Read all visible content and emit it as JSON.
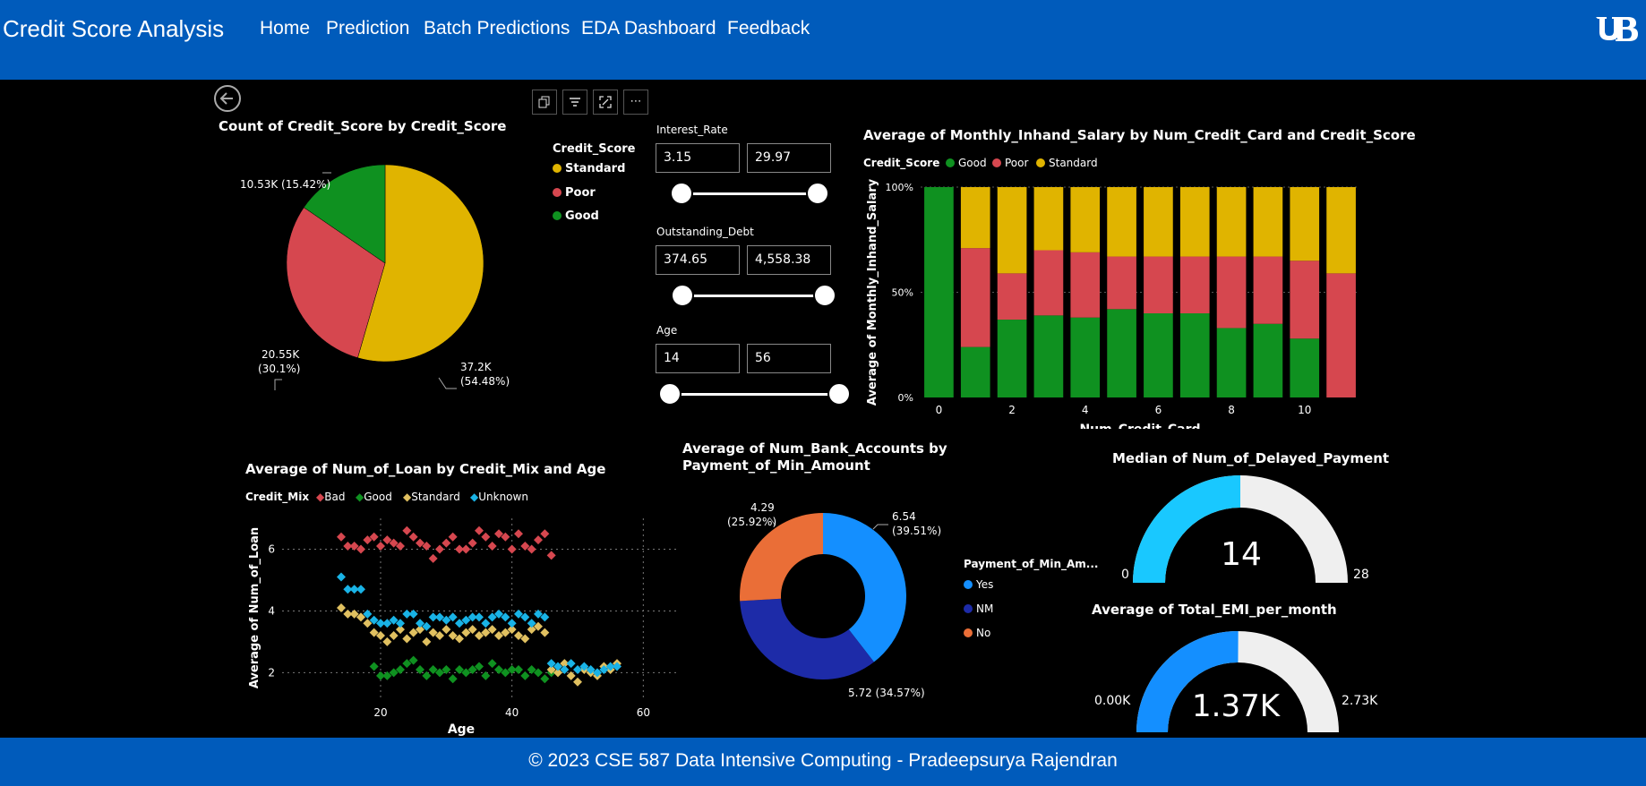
{
  "nav": {
    "brand": "Credit Score Analysis",
    "items": [
      "Home",
      "Prediction",
      "Batch Predictions",
      "EDA Dashboard",
      "Feedback"
    ],
    "logo": "ub-logo"
  },
  "footer": {
    "text": "© 2023 CSE 587 Data Intensive Computing - Pradeepsurya Rajendran"
  },
  "toolbar": {
    "icons": [
      "back-arrow-icon",
      "copy-icon",
      "filter-icon",
      "focus-mode-icon",
      "more-options-icon"
    ],
    "more_label": "⋯"
  },
  "colors": {
    "standard": "#e0b400",
    "poor": "#d6474f",
    "good": "#0f9120",
    "bad": "#d6474f",
    "unknown": "#19b3e6",
    "yes": "#148fff",
    "nm": "#1d2ba8",
    "no": "#ea6e37",
    "nav": "#005bbb",
    "gauge_track": "#efefef"
  },
  "pie": {
    "title": "Count of Credit_Score by Credit_Score",
    "legend_title": "Credit_Score",
    "legend": [
      "Standard",
      "Poor",
      "Good"
    ],
    "labels": {
      "good": "10.53K (15.42%)",
      "poor_1": "20.55K",
      "poor_2": "(30.1%)",
      "standard_1": "37.2K",
      "standard_2": "(54.48%)"
    }
  },
  "slicers": {
    "interest": {
      "title": "Interest_Rate",
      "min": "3.15",
      "max": "29.97"
    },
    "debt": {
      "title": "Outstanding_Debt",
      "min": "374.65",
      "max": "4,558.38"
    },
    "age": {
      "title": "Age",
      "min": "14",
      "max": "56"
    }
  },
  "bar": {
    "title": "Average of Monthly_Inhand_Salary by Num_Credit_Card and Credit_Score",
    "legend_title": "Credit_Score",
    "legend": [
      "Good",
      "Poor",
      "Standard"
    ],
    "ylabel": "Average of Monthly_Inhand_Salary",
    "xlabel": "Num_Credit_Card",
    "yticks": [
      "100%",
      "50%",
      "0%"
    ],
    "xticks": [
      "0",
      "2",
      "4",
      "6",
      "8",
      "10"
    ]
  },
  "scatter": {
    "title": "Average of Num_of_Loan by Credit_Mix and Age",
    "legend_title": "Credit_Mix",
    "legend": [
      "Bad",
      "Good",
      "Standard",
      "Unknown"
    ],
    "ylabel": "Average of Num_of_Loan",
    "xlabel": "Age",
    "yticks": [
      "6",
      "4",
      "2"
    ],
    "xticks": [
      "20",
      "40",
      "60"
    ]
  },
  "donut": {
    "title_1": "Average of Num_Bank_Accounts by",
    "title_2": "Payment_of_Min_Amount",
    "legend_title": "Payment_of_Min_Am...",
    "legend": [
      "Yes",
      "NM",
      "No"
    ],
    "labels": {
      "yes_1": "6.54",
      "yes_2": "(39.51%)",
      "nm": "5.72 (34.57%)",
      "no_1": "4.29",
      "no_2": "(25.92%)"
    }
  },
  "gauge1": {
    "title": "Median of Num_of_Delayed_Payment",
    "value": "14",
    "min": "0",
    "max": "28"
  },
  "gauge2": {
    "title": "Average of Total_EMI_per_month",
    "value": "1.37K",
    "min": "0.00K",
    "max": "2.73K"
  },
  "chart_data": [
    {
      "type": "pie",
      "title": "Count of Credit_Score by Credit_Score",
      "categories": [
        "Standard",
        "Poor",
        "Good"
      ],
      "values": [
        37200,
        20550,
        10530
      ],
      "percent": [
        54.48,
        30.1,
        15.42
      ]
    },
    {
      "type": "bar",
      "stacked_percent": true,
      "title": "Average of Monthly_Inhand_Salary by Num_Credit_Card and Credit_Score",
      "xlabel": "Num_Credit_Card",
      "ylabel": "Average of Monthly_Inhand_Salary",
      "ylim": [
        0,
        100
      ],
      "categories": [
        "0",
        "1",
        "2",
        "3",
        "4",
        "5",
        "6",
        "7",
        "8",
        "9",
        "10",
        "11"
      ],
      "series": [
        {
          "name": "Good",
          "values": [
            100,
            24,
            37,
            39,
            38,
            42,
            40,
            40,
            33,
            35,
            28,
            0
          ]
        },
        {
          "name": "Poor",
          "values": [
            0,
            47,
            22,
            31,
            31,
            25,
            27,
            27,
            34,
            32,
            37,
            59
          ]
        },
        {
          "name": "Standard",
          "values": [
            0,
            29,
            41,
            30,
            31,
            33,
            33,
            33,
            33,
            33,
            35,
            41
          ]
        }
      ]
    },
    {
      "type": "scatter",
      "title": "Average of Num_of_Loan by Credit_Mix and Age",
      "xlabel": "Age",
      "ylabel": "Average of Num_of_Loan",
      "xlim": [
        14,
        60
      ],
      "series": [
        {
          "name": "Bad",
          "x": [
            14,
            15,
            16,
            17,
            18,
            19,
            20,
            21,
            22,
            23,
            24,
            25,
            26,
            27,
            28,
            29,
            30,
            31,
            32,
            33,
            34,
            35,
            36,
            37,
            38,
            39,
            40,
            41,
            42,
            43,
            44,
            45,
            46
          ],
          "y": [
            6.4,
            6.1,
            6.1,
            6.0,
            6.3,
            6.4,
            6.1,
            6.3,
            6.2,
            6.1,
            6.6,
            6.4,
            6.2,
            6.1,
            5.7,
            6.0,
            6.2,
            6.4,
            6.0,
            6.0,
            6.2,
            6.6,
            6.4,
            6.1,
            6.5,
            6.4,
            6.0,
            6.5,
            6.1,
            6.0,
            6.3,
            6.5,
            5.8
          ]
        },
        {
          "name": "Good",
          "x": [
            19,
            20,
            21,
            22,
            23,
            24,
            25,
            26,
            27,
            28,
            29,
            30,
            31,
            32,
            33,
            34,
            35,
            36,
            37,
            38,
            39,
            40,
            41,
            42,
            43,
            44,
            45,
            46
          ],
          "y": [
            2.2,
            1.9,
            1.9,
            2.0,
            2.1,
            2.3,
            2.4,
            2.1,
            1.9,
            2.1,
            2.0,
            2.1,
            1.8,
            2.1,
            2.0,
            2.1,
            2.2,
            1.9,
            2.3,
            2.1,
            2.0,
            2.1,
            2.1,
            1.9,
            2.1,
            2.0,
            1.8,
            2.0
          ]
        },
        {
          "name": "Standard",
          "x": [
            14,
            15,
            16,
            17,
            18,
            19,
            20,
            21,
            22,
            23,
            24,
            25,
            26,
            27,
            28,
            29,
            30,
            31,
            32,
            33,
            34,
            35,
            36,
            37,
            38,
            39,
            40,
            41,
            42,
            43,
            44,
            45,
            46,
            47,
            48,
            49,
            50,
            51,
            52,
            53,
            54,
            55,
            56
          ],
          "y": [
            4.1,
            3.9,
            3.9,
            3.8,
            3.6,
            3.3,
            3.2,
            3.0,
            3.2,
            3.4,
            3.1,
            3.3,
            3.4,
            3.0,
            3.3,
            3.2,
            3.4,
            3.2,
            3.1,
            3.3,
            3.4,
            3.2,
            3.3,
            3.4,
            3.2,
            3.3,
            3.4,
            3.2,
            3.1,
            3.4,
            3.5,
            3.3,
            2.1,
            2.0,
            2.3,
            1.9,
            1.7,
            2.1,
            2.0,
            1.9,
            2.2,
            2.1,
            2.3
          ]
        },
        {
          "name": "Unknown",
          "x": [
            14,
            15,
            16,
            17,
            18,
            19,
            20,
            21,
            22,
            23,
            24,
            25,
            26,
            27,
            28,
            29,
            30,
            31,
            32,
            33,
            34,
            35,
            36,
            37,
            38,
            39,
            40,
            41,
            42,
            43,
            44,
            45,
            46,
            47,
            48,
            49,
            50,
            51,
            52,
            53,
            54,
            55,
            56
          ],
          "y": [
            5.1,
            4.7,
            4.7,
            4.7,
            3.9,
            3.7,
            3.6,
            3.6,
            3.7,
            3.6,
            3.9,
            3.9,
            3.6,
            3.5,
            3.8,
            3.8,
            3.7,
            3.8,
            3.6,
            3.7,
            3.8,
            3.8,
            3.6,
            3.8,
            3.9,
            3.8,
            3.6,
            3.9,
            3.8,
            3.6,
            3.9,
            3.8,
            2.3,
            2.2,
            2.1,
            2.3,
            2.1,
            2.2,
            2.1,
            2.0,
            2.1,
            2.2,
            2.2
          ]
        }
      ]
    },
    {
      "type": "pie",
      "donut": true,
      "title": "Average of Num_Bank_Accounts by Payment_of_Min_Amount",
      "categories": [
        "Yes",
        "NM",
        "No"
      ],
      "values": [
        6.54,
        5.72,
        4.29
      ],
      "percent": [
        39.51,
        34.57,
        25.92
      ]
    },
    {
      "type": "gauge",
      "title": "Median of Num_of_Delayed_Payment",
      "value": 14,
      "min": 0,
      "max": 28
    },
    {
      "type": "gauge",
      "title": "Average of Total_EMI_per_month",
      "value": 1370,
      "min": 0,
      "max": 2730
    }
  ]
}
